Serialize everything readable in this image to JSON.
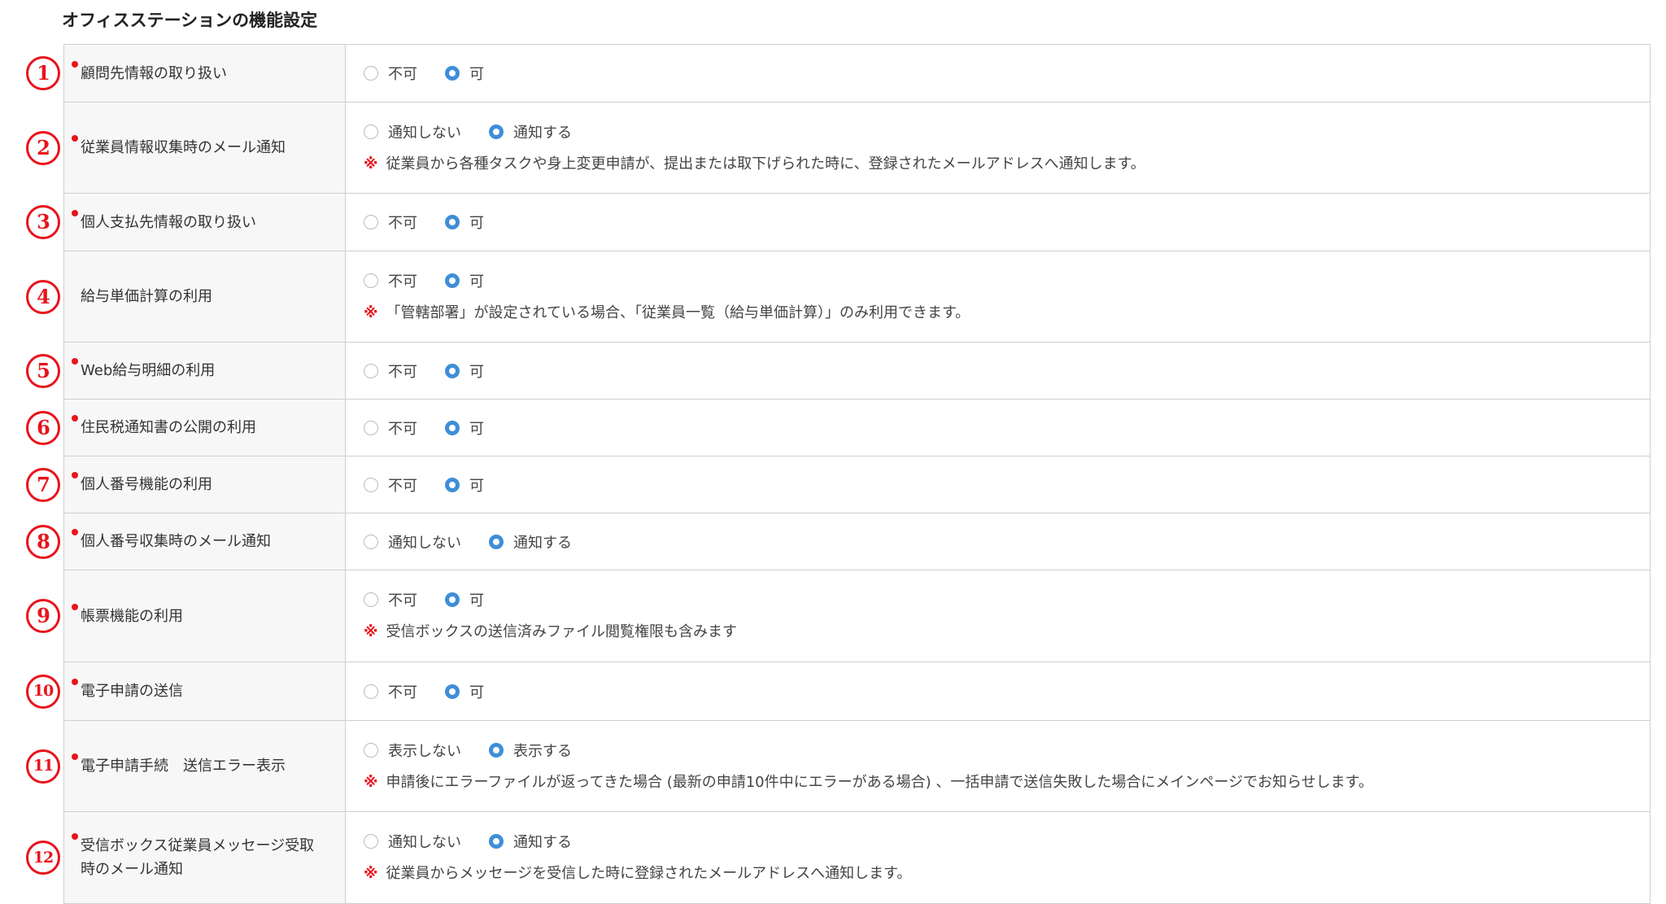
{
  "page_title": "オフィスステーションの機能設定",
  "colors": {
    "required_dot": "#e8141c",
    "number_badge": "#e8141c",
    "radio_selected": "#3e8ed8",
    "note_mark": "#e8141c"
  },
  "rows": [
    {
      "num": "1",
      "required": true,
      "label": "顧問先情報の取り扱い",
      "options": [
        {
          "label": "不可",
          "checked": false
        },
        {
          "label": "可",
          "checked": true
        }
      ]
    },
    {
      "num": "2",
      "required": true,
      "label": "従業員情報収集時のメール通知",
      "options": [
        {
          "label": "通知しない",
          "checked": false
        },
        {
          "label": "通知する",
          "checked": true
        }
      ],
      "note_mark": "※",
      "note": "従業員から各種タスクや身上変更申請が、提出または取下げられた時に、登録されたメールアドレスへ通知します。"
    },
    {
      "num": "3",
      "required": true,
      "label": "個人支払先情報の取り扱い",
      "options": [
        {
          "label": "不可",
          "checked": false
        },
        {
          "label": "可",
          "checked": true
        }
      ]
    },
    {
      "num": "4",
      "required": false,
      "label": "給与単価計算の利用",
      "options": [
        {
          "label": "不可",
          "checked": false
        },
        {
          "label": "可",
          "checked": true
        }
      ],
      "note_mark": "※",
      "note": "「管轄部署」が設定されている場合、「従業員一覧（給与単価計算）」のみ利用できます。"
    },
    {
      "num": "5",
      "required": true,
      "label": "Web給与明細の利用",
      "options": [
        {
          "label": "不可",
          "checked": false
        },
        {
          "label": "可",
          "checked": true
        }
      ]
    },
    {
      "num": "6",
      "required": true,
      "label": "住民税通知書の公開の利用",
      "options": [
        {
          "label": "不可",
          "checked": false
        },
        {
          "label": "可",
          "checked": true
        }
      ]
    },
    {
      "num": "7",
      "required": true,
      "label": "個人番号機能の利用",
      "options": [
        {
          "label": "不可",
          "checked": false
        },
        {
          "label": "可",
          "checked": true
        }
      ]
    },
    {
      "num": "8",
      "required": true,
      "label": "個人番号収集時のメール通知",
      "options": [
        {
          "label": "通知しない",
          "checked": false
        },
        {
          "label": "通知する",
          "checked": true
        }
      ]
    },
    {
      "num": "9",
      "required": true,
      "label": "帳票機能の利用",
      "options": [
        {
          "label": "不可",
          "checked": false
        },
        {
          "label": "可",
          "checked": true
        }
      ],
      "note_mark": "※",
      "note": "受信ボックスの送信済みファイル閲覧権限も含みます"
    },
    {
      "num": "10",
      "required": true,
      "label": "電子申請の送信",
      "options": [
        {
          "label": "不可",
          "checked": false
        },
        {
          "label": "可",
          "checked": true
        }
      ]
    },
    {
      "num": "11",
      "required": true,
      "label": "電子申請手続　送信エラー表示",
      "options": [
        {
          "label": "表示しない",
          "checked": false
        },
        {
          "label": "表示する",
          "checked": true
        }
      ],
      "note_mark": "※",
      "note": "申請後にエラーファイルが返ってきた場合 (最新の申請10件中にエラーがある場合) 、一括申請で送信失敗した場合にメインページでお知らせします。"
    },
    {
      "num": "12",
      "required": true,
      "label": "受信ボックス従業員メッセージ受取時のメール通知",
      "options": [
        {
          "label": "通知しない",
          "checked": false
        },
        {
          "label": "通知する",
          "checked": true
        }
      ],
      "note_mark": "※",
      "note": "従業員からメッセージを受信した時に登録されたメールアドレスへ通知します。"
    }
  ]
}
